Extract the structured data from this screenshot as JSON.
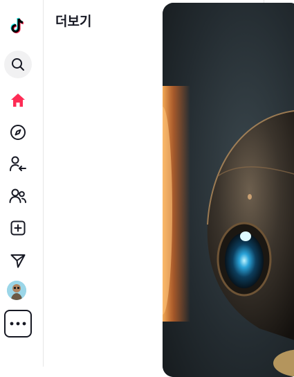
{
  "panel": {
    "title": "더보기"
  },
  "rail": {
    "items": [
      {
        "name": "logo",
        "icon": "tiktok-logo-icon"
      },
      {
        "name": "search",
        "icon": "search-icon"
      },
      {
        "name": "home",
        "icon": "home-icon"
      },
      {
        "name": "explore",
        "icon": "compass-icon"
      },
      {
        "name": "following",
        "icon": "user-follow-icon"
      },
      {
        "name": "friends",
        "icon": "friends-icon"
      },
      {
        "name": "upload",
        "icon": "plus-square-icon"
      },
      {
        "name": "messages",
        "icon": "send-icon"
      },
      {
        "name": "profile",
        "icon": "avatar"
      },
      {
        "name": "more",
        "icon": "more-dots-icon"
      }
    ]
  },
  "colors": {
    "accent": "#fe2c55",
    "icon": "#161823",
    "search_bg": "#f1f1f2"
  }
}
